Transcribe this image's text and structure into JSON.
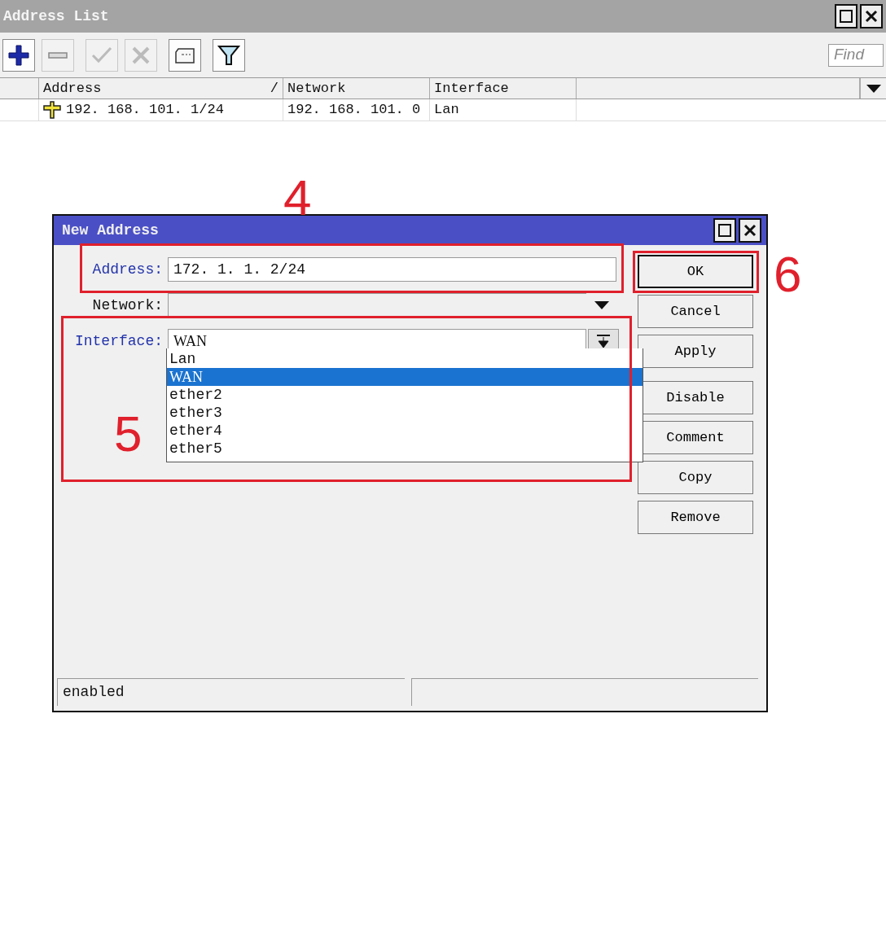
{
  "window": {
    "title": "Address List"
  },
  "toolbar": [
    {
      "kind": "add",
      "disabled": false
    },
    {
      "kind": "remove",
      "disabled": true
    },
    {
      "kind": "enable",
      "disabled": true
    },
    {
      "kind": "disable",
      "disabled": true
    },
    {
      "kind": "comment",
      "disabled": false
    },
    {
      "kind": "filter",
      "disabled": false
    }
  ],
  "find": {
    "placeholder": "Find"
  },
  "table": {
    "columns": [
      {
        "label": "Address",
        "sort_mark": "/"
      },
      {
        "label": "Network"
      },
      {
        "label": "Interface"
      }
    ],
    "rows": [
      {
        "address": "192. 168. 101. 1/24",
        "network": "192. 168. 101. 0",
        "interface": "Lan"
      }
    ]
  },
  "dialog": {
    "title": "New Address",
    "fields": [
      {
        "label": "Address:",
        "value": "172. 1. 1. 2/24",
        "modified": true,
        "kind": "text"
      },
      {
        "label": "Network:",
        "modified": false,
        "kind": "select"
      },
      {
        "label": "Interface:",
        "value": "WAN",
        "modified": true,
        "kind": "combo",
        "expanded": true
      }
    ],
    "options": [
      {
        "label": "Lan",
        "selected": false
      },
      {
        "label": "WAN",
        "selected": true
      },
      {
        "label": "ether2",
        "selected": false
      },
      {
        "label": "ether3",
        "selected": false
      },
      {
        "label": "ether4",
        "selected": false
      },
      {
        "label": "ether5",
        "selected": false
      }
    ],
    "buttons": [
      {
        "label": "OK",
        "default": true
      },
      {
        "label": "Cancel",
        "default": false
      },
      {
        "label": "Apply",
        "default": false
      },
      {
        "label": "Disable",
        "default": false
      },
      {
        "label": "Comment",
        "default": false
      },
      {
        "label": "Copy",
        "default": false
      },
      {
        "label": "Remove",
        "default": false
      }
    ],
    "status": "enabled"
  },
  "annotations": [
    {
      "label": "4"
    },
    {
      "label": "5"
    },
    {
      "label": "6"
    }
  ]
}
